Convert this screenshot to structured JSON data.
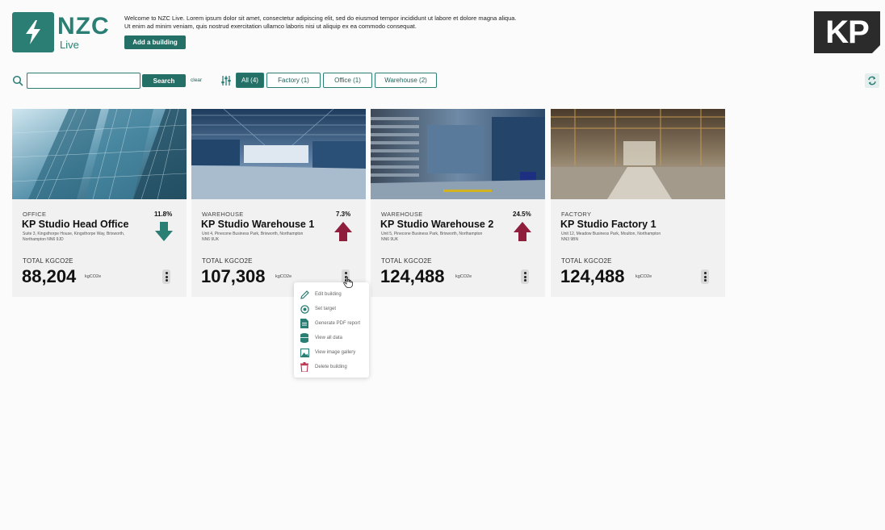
{
  "brand": {
    "logo_text": "NZC",
    "logo_sub": "Live",
    "corner_logo": "KP"
  },
  "header": {
    "welcome_line1": "Welcome to NZC Live. Lorem ipsum dolor sit amet, consectetur adipiscing elit, sed do eiusmod tempor incididunt ut labore et dolore magna aliqua.",
    "welcome_line2": "Ut enim ad minim veniam, quis nostrud exercitation ullamco laboris nisi ut aliquip ex ea commodo consequat.",
    "add_building_label": "Add a building"
  },
  "toolbar": {
    "search_value": "",
    "search_placeholder": "",
    "search_button": "Search",
    "clear_label": "clear",
    "filters": [
      "All (4)",
      "Factory (1)",
      "Office (1)",
      "Warehouse (2)"
    ],
    "active_filter": "All (4)"
  },
  "cards": [
    {
      "category": "OFFICE",
      "title": "KP Studio Head Office",
      "address": "Suite 3, Kingsthorpe House, Kingsthorpe Way, Brixworth, Northampton NN6 9JD",
      "change": "11.8%",
      "trend": "down",
      "total_label": "TOTAL KGCO2E",
      "total": "88,204",
      "unit": "kgCO2e"
    },
    {
      "category": "WAREHOUSE",
      "title": "KP Studio Warehouse 1",
      "address": "Unit 4, Pinecone Business Park, Brixworth, Northampton NN6 9UK",
      "change": "7.3%",
      "trend": "up",
      "total_label": "TOTAL KGCO2E",
      "total": "107,308",
      "unit": "kgCO2e"
    },
    {
      "category": "WAREHOUSE",
      "title": "KP Studio Warehouse 2",
      "address": "Unit 5, Pinecone Business Park, Brixworth, Northampton NN6 9UK",
      "change": "24.5%",
      "trend": "up",
      "total_label": "TOTAL KGCO2E",
      "total": "124,488",
      "unit": "kgCO2e"
    },
    {
      "category": "FACTORY",
      "title": "KP Studio Factory 1",
      "address": "Unit 12, Meadow Business Park, Moulton, Northampton NN3 9BN",
      "change": "",
      "trend": "none",
      "total_label": "TOTAL KGCO2E",
      "total": "124,488",
      "unit": "kgCO2e"
    }
  ],
  "context_menu": {
    "items": [
      {
        "label": "Edit building",
        "icon": "pencil-icon"
      },
      {
        "label": "Set target",
        "icon": "target-icon"
      },
      {
        "label": "Generate PDF report",
        "icon": "pdf-icon"
      },
      {
        "label": "View all data",
        "icon": "database-icon"
      },
      {
        "label": "View image gallery",
        "icon": "image-icon"
      },
      {
        "label": "Delete building",
        "icon": "trash-icon"
      }
    ]
  },
  "colors": {
    "brand": "#2a7e74",
    "button": "#246f66",
    "down": "#2a7e74",
    "up": "#8f1d3c",
    "delete": "#b8324e"
  }
}
